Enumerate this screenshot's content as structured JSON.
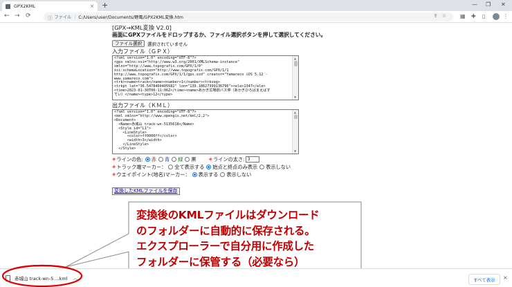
{
  "browser": {
    "tab_title": "GPX2KML",
    "tab_close": "×",
    "new_tab": "+",
    "back": "←",
    "forward": "→",
    "reload": "⟳",
    "address_scheme": "ファイル",
    "address_url": "C:/Users/user/Documents/野風/GPX2KML変換.htm"
  },
  "page": {
    "title": "[GPX→KML変換 V2.0]",
    "description": "画面にGPXファイルをドロップするか、ファイル選択ボタンを押して選択してください。",
    "file_button": "ファイル選択",
    "file_status": "選択されていません",
    "input_label": "入力ファイル（ＧＰＸ）",
    "input_lines": [
      "<?xml version=\"1.0\" encoding=\"UTF-8\"?>",
      "<gpx xmlns:xsi=\"http://www.w3.org/2001/XMLSchema-instance\"",
      "xmlns=\"http://www.topografix.com/GPX/1/0\"",
      "xsi:schemaLocation=\"http://www.topografix.com/GPX/1/1",
      "http://www.topografix.com/GPX/1/1/gpx.xsd\" creator=\"Yamareco iOS 5.12 -",
      "www.yamareco.com\">",
      "<trk><name>track</name><number>1</number><trkseg>",
      "<trkpt lat=\"36.5478460405582\" lon=\"139.18627399136796\"><ele>1347</ele>",
      "<time>2023-01-30T00:11:06Z</time><name>あかぎ広場前バス停（あかぎひろばまえばす",
      "てい）</name><type>12</type>"
    ],
    "output_label": "出力ファイル（ＫＭＬ）",
    "output_lines": [
      "<?xml version=\"1.0\" encoding=\"UTF-8\"?>",
      "<kml xmlns=\"http://www.opengis.net/kml/2.2\">",
      "<Document>",
      "  <Name>赤城山 track-wn-5135618</Name>",
      "  <Style id=\"L1\">",
      "    <LineStyle>",
      "      <color>ff0000ff</color>",
      "      <width>3</width>",
      "    </LineStyle>",
      "  </Style>"
    ],
    "line_color_label": "ラインの色:",
    "colors": [
      "赤",
      "青",
      "緑",
      "黒"
    ],
    "line_width_label": "ラインの太さ:",
    "line_width_value": "3",
    "track_marker_label": "トラック端マーカー：",
    "marker_options": [
      "全て表示する",
      "始点と終点のみ表示",
      "表示しない"
    ],
    "waypoint_label": "ウエイポイント(地名)マーカー：",
    "waypoint_options": [
      "表示する",
      "表示しない"
    ],
    "save_button": "変換したKMLファイルを保存"
  },
  "annotation": {
    "lines": [
      "変換後のKMLファイルはダウンロード",
      "のフォルダーに自動的に保存される。",
      "エクスプローラーで自分用に作成した",
      "フォルダーに保管する（必要なら）"
    ],
    "color": "#c00000",
    "ellipse_color": "#e00000"
  },
  "download_bar": {
    "file_name": "赤城山 track-wn-5....kml",
    "show_all": "すべて表示",
    "close": "×"
  },
  "state": {
    "selected_color": "赤",
    "selected_marker": "始点と終点のみ表示",
    "selected_waypoint": "表示する"
  }
}
